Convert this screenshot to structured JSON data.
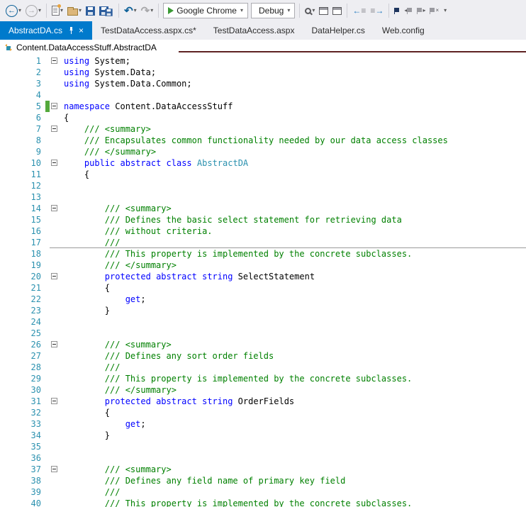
{
  "toolbar": {
    "run_target_label": "Google Chrome",
    "config_label": "Debug"
  },
  "icons": {
    "back": "←",
    "forward": "→",
    "undo": "↶",
    "redo": "↷",
    "chevron_down": "▾",
    "close": "×",
    "indent_lines": "≡",
    "arrow_right": "→",
    "arrow_left": "←",
    "prev": "◂",
    "next": "▸"
  },
  "tab_bar": {
    "tabs": [
      {
        "label": "AbstractDA.cs",
        "active": true
      },
      {
        "label": "TestDataAccess.aspx.cs*",
        "active": false
      },
      {
        "label": "TestDataAccess.aspx",
        "active": false
      },
      {
        "label": "DataHelper.cs",
        "active": false
      },
      {
        "label": "Web.config",
        "active": false
      }
    ]
  },
  "breadcrumb": {
    "path": "Content.DataAccessStuff.AbstractDA"
  },
  "editor": {
    "syntax_colors": {
      "keyword": "#0000ff",
      "type": "#2b91af",
      "comment": "#008000",
      "plain": "#000000",
      "line_number": "#2b91af",
      "change_bar_saved": "#54a93c",
      "active_tab": "#007acc"
    },
    "lines": [
      {
        "n": 1,
        "fold": true,
        "segs": [
          [
            "kw",
            "using"
          ],
          [
            "pl",
            " System;"
          ]
        ]
      },
      {
        "n": 2,
        "segs": [
          [
            "kw",
            "using"
          ],
          [
            "pl",
            " System.Data;"
          ]
        ]
      },
      {
        "n": 3,
        "segs": [
          [
            "kw",
            "using"
          ],
          [
            "pl",
            " System.Data.Common;"
          ]
        ]
      },
      {
        "n": 4,
        "segs": []
      },
      {
        "n": 5,
        "fold": true,
        "change": true,
        "segs": [
          [
            "kw",
            "namespace"
          ],
          [
            "pl",
            " Content.DataAccessStuff"
          ]
        ]
      },
      {
        "n": 6,
        "segs": [
          [
            "pl",
            "{"
          ]
        ]
      },
      {
        "n": 7,
        "fold": true,
        "segs": [
          [
            "cm",
            "    /// <summary>"
          ]
        ]
      },
      {
        "n": 8,
        "segs": [
          [
            "cm",
            "    /// Encapsulates common functionality needed by our data access classes"
          ]
        ]
      },
      {
        "n": 9,
        "segs": [
          [
            "cm",
            "    /// </summary>"
          ]
        ]
      },
      {
        "n": 10,
        "fold": true,
        "segs": [
          [
            "pl",
            "    "
          ],
          [
            "kw",
            "public"
          ],
          [
            "pl",
            " "
          ],
          [
            "kw",
            "abstract"
          ],
          [
            "pl",
            " "
          ],
          [
            "kw",
            "class"
          ],
          [
            "pl",
            " "
          ],
          [
            "ty",
            "AbstractDA"
          ]
        ]
      },
      {
        "n": 11,
        "segs": [
          [
            "pl",
            "    {"
          ]
        ]
      },
      {
        "n": 12,
        "segs": []
      },
      {
        "n": 13,
        "segs": []
      },
      {
        "n": 14,
        "fold": true,
        "segs": [
          [
            "cm",
            "        /// <summary>"
          ]
        ]
      },
      {
        "n": 15,
        "segs": [
          [
            "cm",
            "        /// Defines the basic select statement for retrieving data"
          ]
        ]
      },
      {
        "n": 16,
        "segs": [
          [
            "cm",
            "        /// without criteria."
          ]
        ]
      },
      {
        "n": 17,
        "underline": true,
        "segs": [
          [
            "cm",
            "        ///"
          ]
        ]
      },
      {
        "n": 18,
        "segs": [
          [
            "cm",
            "        /// This property is implemented by the concrete subclasses."
          ]
        ]
      },
      {
        "n": 19,
        "segs": [
          [
            "cm",
            "        /// </summary>"
          ]
        ]
      },
      {
        "n": 20,
        "fold": true,
        "segs": [
          [
            "pl",
            "        "
          ],
          [
            "kw",
            "protected"
          ],
          [
            "pl",
            " "
          ],
          [
            "kw",
            "abstract"
          ],
          [
            "pl",
            " "
          ],
          [
            "kw",
            "string"
          ],
          [
            "pl",
            " SelectStatement"
          ]
        ]
      },
      {
        "n": 21,
        "segs": [
          [
            "pl",
            "        {"
          ]
        ]
      },
      {
        "n": 22,
        "segs": [
          [
            "pl",
            "            "
          ],
          [
            "kw",
            "get"
          ],
          [
            "pl",
            ";"
          ]
        ]
      },
      {
        "n": 23,
        "segs": [
          [
            "pl",
            "        }"
          ]
        ]
      },
      {
        "n": 24,
        "segs": []
      },
      {
        "n": 25,
        "segs": []
      },
      {
        "n": 26,
        "fold": true,
        "segs": [
          [
            "cm",
            "        /// <summary>"
          ]
        ]
      },
      {
        "n": 27,
        "segs": [
          [
            "cm",
            "        /// Defines any sort order fields"
          ]
        ]
      },
      {
        "n": 28,
        "segs": [
          [
            "cm",
            "        ///"
          ]
        ]
      },
      {
        "n": 29,
        "segs": [
          [
            "cm",
            "        /// This property is implemented by the concrete subclasses."
          ]
        ]
      },
      {
        "n": 30,
        "segs": [
          [
            "cm",
            "        /// </summary>"
          ]
        ]
      },
      {
        "n": 31,
        "fold": true,
        "segs": [
          [
            "pl",
            "        "
          ],
          [
            "kw",
            "protected"
          ],
          [
            "pl",
            " "
          ],
          [
            "kw",
            "abstract"
          ],
          [
            "pl",
            " "
          ],
          [
            "kw",
            "string"
          ],
          [
            "pl",
            " OrderFields"
          ]
        ]
      },
      {
        "n": 32,
        "segs": [
          [
            "pl",
            "        {"
          ]
        ]
      },
      {
        "n": 33,
        "segs": [
          [
            "pl",
            "            "
          ],
          [
            "kw",
            "get"
          ],
          [
            "pl",
            ";"
          ]
        ]
      },
      {
        "n": 34,
        "segs": [
          [
            "pl",
            "        }"
          ]
        ]
      },
      {
        "n": 35,
        "segs": []
      },
      {
        "n": 36,
        "segs": []
      },
      {
        "n": 37,
        "fold": true,
        "segs": [
          [
            "cm",
            "        /// <summary>"
          ]
        ]
      },
      {
        "n": 38,
        "segs": [
          [
            "cm",
            "        /// Defines any field name of primary key field"
          ]
        ]
      },
      {
        "n": 39,
        "segs": [
          [
            "cm",
            "        ///"
          ]
        ]
      },
      {
        "n": 40,
        "segs": [
          [
            "cm",
            "        /// This property is implemented by the concrete subclasses."
          ]
        ]
      }
    ]
  }
}
